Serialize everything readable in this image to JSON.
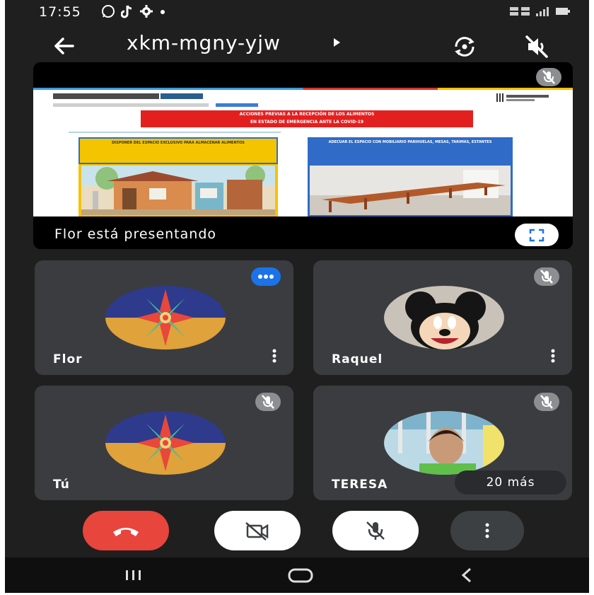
{
  "status": {
    "time": "17:55",
    "icons": [
      "whatsapp-icon",
      "tiktok-icon",
      "gear-icon",
      "dot-icon"
    ],
    "right_icons": [
      "network-icon",
      "signal-icon",
      "battery-icon"
    ]
  },
  "header": {
    "meeting_code": "xkm-mgny-yjw",
    "icons": [
      "back-arrow-icon",
      "caret-right-icon",
      "switch-camera-icon",
      "speaker-off-icon"
    ]
  },
  "presentation": {
    "label": "Flor está presentando",
    "slide": {
      "title_line1": "ACCIONES PREVIAS A LA RECEPCIÓN DE LOS ALIMENTOS",
      "title_line2": "EN ESTADO DE EMERGENCIA ANTE LA COVID-19",
      "left_box": "DISPONER DEL ESPACIO EXCLUSIVO PARA ALMACENAR ALIMENTOS",
      "right_box": "ADECUAR EL ESPACIO CON MOBILIARIO PARIHUELAS, MESAS, TARIMAS, ESTANTES"
    }
  },
  "participants": [
    {
      "name": "Flor"
    },
    {
      "name": "Raquel"
    },
    {
      "name": "Tú"
    },
    {
      "name": "TERESA"
    }
  ],
  "more_participants": "20 más",
  "colors": {
    "background": "#1f1f1f",
    "tile": "#3b3c3f",
    "end_call": "#e8453c",
    "active_options": "#1a73e8"
  }
}
